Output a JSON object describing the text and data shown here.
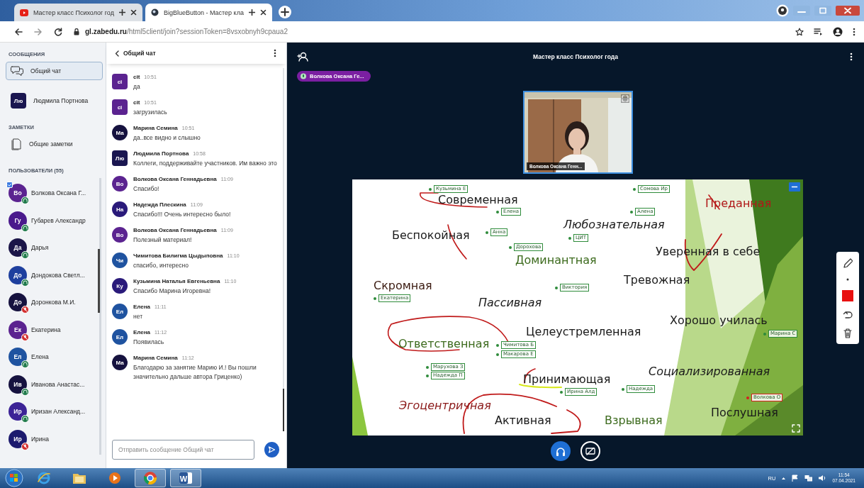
{
  "browser": {
    "tabs": [
      {
        "title": "Мастер класс Психолог год",
        "kind": "youtube",
        "selected": false
      },
      {
        "title": "BigBlueButton - Мастер кла",
        "kind": "bbb",
        "selected": true
      }
    ],
    "address": "gl.zabedu.ru/html5client/join?sessionToken=8vsxobnyh9cpaua2"
  },
  "sidebar": {
    "messages_heading": "СООБЩЕНИЯ",
    "messages": [
      {
        "label": "Общий чат",
        "kind": "public",
        "selected": true
      },
      {
        "label": "Людмила Портнова",
        "kind": "private",
        "initials": "Лю",
        "color": "#1a1650",
        "selected": false
      }
    ],
    "notes_heading": "ЗАМЕТКИ",
    "notes": [
      {
        "label": "Общие заметки"
      }
    ],
    "users_heading": "ПОЛЬЗОВАТЕЛИ (55)",
    "users": [
      {
        "name": "Волкова Оксана Г...",
        "initials": "Во",
        "color": "#5b2390",
        "muted": false,
        "presenter": true
      },
      {
        "name": "Губарев Александр",
        "initials": "Гу",
        "color": "#4a1a8c",
        "muted": false,
        "presenter": false
      },
      {
        "name": "Дарья",
        "initials": "Да",
        "color": "#1b1548",
        "muted": false,
        "presenter": false
      },
      {
        "name": "Дондокова Светл...",
        "initials": "До",
        "color": "#1e3f9e",
        "muted": false,
        "presenter": false
      },
      {
        "name": "Доронкова М.И.",
        "initials": "До",
        "color": "#16123f",
        "muted": true,
        "presenter": false
      },
      {
        "name": "Екатерина",
        "initials": "Ек",
        "color": "#5b2390",
        "muted": true,
        "presenter": false
      },
      {
        "name": "Елена",
        "initials": "Ел",
        "color": "#1f53a0",
        "muted": false,
        "presenter": false
      },
      {
        "name": "Иванова Анастас...",
        "initials": "Ив",
        "color": "#16123f",
        "muted": false,
        "presenter": false
      },
      {
        "name": "Иризан Александ...",
        "initials": "Ир",
        "color": "#3c2396",
        "muted": false,
        "presenter": false
      },
      {
        "name": "Ирина",
        "initials": "Ир",
        "color": "#1c1a6e",
        "muted": true,
        "presenter": false
      }
    ]
  },
  "chat": {
    "title": "Общий чат",
    "messages": [
      {
        "author": "cit",
        "time": "10:51",
        "text": "да",
        "initials": "ci",
        "color": "#5b2390",
        "moderator": true
      },
      {
        "author": "cit",
        "time": "10:51",
        "text": "загрузилась",
        "initials": "ci",
        "color": "#5b2390",
        "moderator": true
      },
      {
        "author": "Марина Семина",
        "time": "10:51",
        "text": "да..все видно и слышно",
        "initials": "Ма",
        "color": "#16123f",
        "moderator": false
      },
      {
        "author": "Людмила Портнова",
        "time": "10:58",
        "text": "Коллеги, поддерживайте участников. Им важно это",
        "initials": "Лю",
        "color": "#1a1650",
        "moderator": true
      },
      {
        "author": "Волкова Оксана Геннадьевна",
        "time": "11:09",
        "text": "Спасибо!",
        "initials": "Во",
        "color": "#5b2390",
        "moderator": false
      },
      {
        "author": "Надежда Плескина",
        "time": "11:09",
        "text": "Спасибо!!! Очень интересно было!",
        "initials": "На",
        "color": "#2a1a7a",
        "moderator": false
      },
      {
        "author": "Волкова Оксана Геннадьевна",
        "time": "11:09",
        "text": "Полезный материал!",
        "initials": "Во",
        "color": "#5b2390",
        "moderator": false
      },
      {
        "author": "Чимитова Билигма Цыдыповна",
        "time": "11:10",
        "text": "спасибо, интересно",
        "initials": "Чи",
        "color": "#1f53a0",
        "moderator": false
      },
      {
        "author": "Кузьмина Наталья Евгеньевна",
        "time": "11:10",
        "text": "Спасибо Марина Игоревна!",
        "initials": "Ку",
        "color": "#2a1a7a",
        "moderator": false
      },
      {
        "author": "Елена",
        "time": "11:11",
        "text": "нет",
        "initials": "Ел",
        "color": "#1f53a0",
        "moderator": false
      },
      {
        "author": "Елена",
        "time": "11:12",
        "text": "Появилась",
        "initials": "Ел",
        "color": "#1f53a0",
        "moderator": false
      },
      {
        "author": "Марина Семина",
        "time": "11:12",
        "text": "Благодарю за занятие Марию И.! Вы пошли значительно дальше автора Гриценко)",
        "initials": "Ма",
        "color": "#16123f",
        "moderator": false
      }
    ],
    "placeholder": "Отправить сообщение Общий чат"
  },
  "meeting": {
    "title": "Мастер класс Психолог года",
    "talking": "Волкова Оксана Ге...",
    "webcam": {
      "kind": "picture",
      "name": "Волкова Оксана Генн..."
    },
    "whiteboard": {
      "words": [
        {
          "text": "Современная",
          "color": "#1a1a1a",
          "italic": false
        },
        {
          "text": "Преданная",
          "color": "#b01818",
          "italic": false
        },
        {
          "text": "Любознательная",
          "color": "#1a1a1a",
          "italic": true
        },
        {
          "text": "Беспокойная",
          "color": "#1a1a1a",
          "italic": false
        },
        {
          "text": "Уверенная в себе",
          "color": "#1a1a1a",
          "italic": false
        },
        {
          "text": "Доминантная",
          "color": "#3d6b1e",
          "italic": false
        },
        {
          "text": "Тревожная",
          "color": "#1a1a1a",
          "italic": false
        },
        {
          "text": "Скромная",
          "color": "#3a1a10",
          "italic": false
        },
        {
          "text": "Пассивная",
          "color": "#1a1a1a",
          "italic": true
        },
        {
          "text": "Хорошо училась",
          "color": "#1a1a1a",
          "italic": false
        },
        {
          "text": "Целеустремленная",
          "color": "#1a1a1a",
          "italic": false
        },
        {
          "text": "Ответственная",
          "color": "#3d6b1e",
          "italic": false
        },
        {
          "text": "Социализированная",
          "color": "#1a1a1a",
          "italic": true
        },
        {
          "text": "Принимающая",
          "color": "#1a1a1a",
          "italic": false
        },
        {
          "text": "Эгоцентричная",
          "color": "#8b1a1a",
          "italic": true
        },
        {
          "text": "Послушная",
          "color": "#1a1a1a",
          "italic": false
        },
        {
          "text": "Активная",
          "color": "#1a1a1a",
          "italic": false
        },
        {
          "text": "Взрывная",
          "color": "#3d6b1e",
          "italic": false
        }
      ],
      "cursors": [
        {
          "name": "Кузьмина Е",
          "color": "#2e8b3a"
        },
        {
          "name": "Елена",
          "color": "#2e8b3a"
        },
        {
          "name": "Анна",
          "color": "#2e8b3a"
        },
        {
          "name": "Дорохова",
          "color": "#2e8b3a"
        },
        {
          "name": "Алена",
          "color": "#2e8b3a"
        },
        {
          "name": "ЦИТ",
          "color": "#2e8b3a"
        },
        {
          "name": "Сомова Ир",
          "color": "#2e8b3a"
        },
        {
          "name": "Екатерина",
          "color": "#2e8b3a"
        },
        {
          "name": "Виктория",
          "color": "#2e8b3a"
        },
        {
          "name": "Чимитова Б",
          "color": "#2e8b3a"
        },
        {
          "name": "Макарова Е",
          "color": "#2e8b3a"
        },
        {
          "name": "Марухова З",
          "color": "#2e8b3a"
        },
        {
          "name": "Надежда П",
          "color": "#2e8b3a"
        },
        {
          "name": "Надежда",
          "color": "#2e8b3a"
        },
        {
          "name": "Ирина Алд",
          "color": "#2e8b3a"
        },
        {
          "name": "Марина С",
          "color": "#2e8b3a"
        },
        {
          "name": "Волкова О",
          "color": "#d42020"
        }
      ]
    }
  },
  "taskbar": {
    "apps": [
      {
        "kind": "ie",
        "running": false
      },
      {
        "kind": "folder",
        "running": false
      },
      {
        "kind": "media",
        "running": false
      },
      {
        "kind": "chrome",
        "running": true
      },
      {
        "kind": "word",
        "label": "W",
        "running": true
      }
    ],
    "language": "RU",
    "time": "11:54",
    "date": "07.04.2021"
  }
}
